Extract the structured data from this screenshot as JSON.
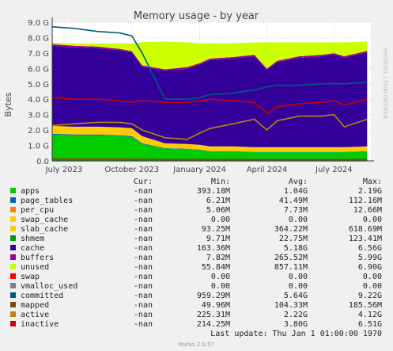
{
  "chart_data": {
    "type": "area",
    "title": "Memory usage - by year",
    "ylabel": "Bytes",
    "xlabel": "",
    "side_label": "RRDTOOL / TOBI OETIKER",
    "footer": "Munin 2.0.57",
    "ylim": [
      0,
      9000000000
    ],
    "xlim": [
      "2023-06-15",
      "2024-08-20"
    ],
    "grid": true,
    "y_ticks": [
      {
        "value": 0,
        "label": "0.0"
      },
      {
        "value": 1000000000,
        "label": "1.0 G"
      },
      {
        "value": 2000000000,
        "label": "2.0 G"
      },
      {
        "value": 3000000000,
        "label": "3.0 G"
      },
      {
        "value": 4000000000,
        "label": "4.0 G"
      },
      {
        "value": 5000000000,
        "label": "5.0 G"
      },
      {
        "value": 6000000000,
        "label": "6.0 G"
      },
      {
        "value": 7000000000,
        "label": "7.0 G"
      },
      {
        "value": 8000000000,
        "label": "8.0 G"
      },
      {
        "value": 9000000000,
        "label": "9.0 G"
      }
    ],
    "x_ticks": [
      {
        "date": "2023-07-01",
        "label": "July 2023"
      },
      {
        "date": "2023-10-01",
        "label": "October 2023"
      },
      {
        "date": "2024-01-01",
        "label": "January 2024"
      },
      {
        "date": "2024-04-01",
        "label": "April 2024"
      },
      {
        "date": "2024-07-01",
        "label": "July 2024"
      }
    ],
    "x": [
      "2023-06-15",
      "2023-07-15",
      "2023-08-15",
      "2023-09-15",
      "2023-10-01",
      "2023-10-15",
      "2023-11-15",
      "2023-12-15",
      "2024-01-01",
      "2024-01-15",
      "2024-02-15",
      "2024-03-15",
      "2024-04-01",
      "2024-04-15",
      "2024-05-15",
      "2024-06-15",
      "2024-07-01",
      "2024-07-15",
      "2024-08-15"
    ],
    "legend_header": {
      "cur": "Cur:",
      "min": "Min:",
      "avg": "Avg:",
      "max": "Max:"
    },
    "series": [
      {
        "name": "apps",
        "color": "#00cc00",
        "stacked": true,
        "cur": "-nan",
        "min": "393.18M",
        "avg": "1.04G",
        "max": "2.19G",
        "values": [
          1700000000,
          1650000000,
          1650000000,
          1600000000,
          1550000000,
          1100000000,
          800000000,
          750000000,
          700000000,
          600000000,
          600000000,
          550000000,
          550000000,
          550000000,
          550000000,
          550000000,
          550000000,
          550000000,
          600000000
        ]
      },
      {
        "name": "page_tables",
        "color": "#0066b3",
        "stacked": true,
        "cur": "-nan",
        "min": "6.21M",
        "avg": "41.49M",
        "max": "112.16M",
        "values": [
          60000000,
          60000000,
          60000000,
          60000000,
          60000000,
          40000000,
          30000000,
          30000000,
          30000000,
          30000000,
          30000000,
          30000000,
          30000000,
          30000000,
          30000000,
          30000000,
          30000000,
          30000000,
          30000000
        ]
      },
      {
        "name": "per_cpu",
        "color": "#ff8000",
        "stacked": true,
        "cur": "-nan",
        "min": "5.06M",
        "avg": "7.73M",
        "max": "12.66M",
        "values": [
          8000000,
          8000000,
          8000000,
          8000000,
          8000000,
          8000000,
          8000000,
          8000000,
          8000000,
          8000000,
          8000000,
          8000000,
          8000000,
          8000000,
          8000000,
          8000000,
          8000000,
          8000000,
          8000000
        ]
      },
      {
        "name": "swap_cache",
        "color": "#ffcc00",
        "stacked": true,
        "cur": "-nan",
        "min": "0.00",
        "avg": "0.00",
        "max": "0.00",
        "values": [
          0,
          0,
          0,
          0,
          0,
          0,
          0,
          0,
          0,
          0,
          0,
          0,
          0,
          0,
          0,
          0,
          0,
          0,
          0
        ]
      },
      {
        "name": "slab_cache",
        "color": "#ffcc00",
        "stacked": true,
        "cur": "-nan",
        "min": "93.25M",
        "avg": "364.22M",
        "max": "618.69M",
        "values": [
          500000000,
          500000000,
          500000000,
          500000000,
          500000000,
          450000000,
          300000000,
          300000000,
          300000000,
          300000000,
          300000000,
          300000000,
          300000000,
          300000000,
          300000000,
          300000000,
          300000000,
          300000000,
          300000000
        ]
      },
      {
        "name": "shmem",
        "color": "#009900",
        "stacked": false,
        "cur": "-nan",
        "min": "9.71M",
        "avg": "22.75M",
        "max": "123.41M",
        "values": [
          20000000,
          20000000,
          20000000,
          20000000,
          20000000,
          20000000,
          20000000,
          20000000,
          20000000,
          20000000,
          20000000,
          20000000,
          20000000,
          20000000,
          20000000,
          20000000,
          20000000,
          20000000,
          20000000
        ]
      },
      {
        "name": "cache",
        "color": "#330099",
        "stacked": true,
        "cur": "-nan",
        "min": "163.36M",
        "avg": "5.18G",
        "max": "6.56G",
        "values": [
          5200000000,
          5150000000,
          5100000000,
          5000000000,
          4900000000,
          4500000000,
          4700000000,
          4900000000,
          5200000000,
          5600000000,
          5700000000,
          5900000000,
          5000000000,
          5500000000,
          5800000000,
          5900000000,
          6000000000,
          5800000000,
          6100000000
        ]
      },
      {
        "name": "buffers",
        "color": "#990099",
        "stacked": true,
        "cur": "-nan",
        "min": "7.82M",
        "avg": "265.52M",
        "max": "5.99G",
        "values": [
          100000000,
          100000000,
          100000000,
          100000000,
          100000000,
          100000000,
          100000000,
          100000000,
          100000000,
          100000000,
          100000000,
          100000000,
          100000000,
          100000000,
          100000000,
          100000000,
          100000000,
          100000000,
          100000000
        ]
      },
      {
        "name": "unused",
        "color": "#ccff00",
        "stacked": true,
        "cur": "-nan",
        "min": "55.84M",
        "avg": "857.11M",
        "max": "6.90G",
        "values": [
          100000000,
          150000000,
          200000000,
          350000000,
          500000000,
          1500000000,
          1800000000,
          1600000000,
          1300000000,
          1000000000,
          900000000,
          800000000,
          1700000000,
          1200000000,
          900000000,
          800000000,
          700000000,
          900000000,
          600000000
        ]
      },
      {
        "name": "swap",
        "color": "#ff0000",
        "stacked": true,
        "cur": "-nan",
        "min": "0.00",
        "avg": "0.00",
        "max": "0.00",
        "values": [
          0,
          0,
          0,
          0,
          0,
          0,
          0,
          0,
          0,
          0,
          0,
          0,
          0,
          0,
          0,
          0,
          0,
          0,
          0
        ]
      },
      {
        "name": "vmalloc_used",
        "color": "#808080",
        "stacked": false,
        "cur": "-nan",
        "min": "0.00",
        "avg": "0.00",
        "max": "0.00",
        "values": [
          0,
          0,
          0,
          0,
          0,
          0,
          0,
          0,
          0,
          0,
          0,
          0,
          0,
          0,
          0,
          0,
          0,
          0,
          0
        ]
      },
      {
        "name": "committed",
        "color": "#005a80",
        "stacked": false,
        "cur": "-nan",
        "min": "959.29M",
        "avg": "5.64G",
        "max": "9.22G",
        "values": [
          8700000000,
          8600000000,
          8400000000,
          8300000000,
          8100000000,
          7000000000,
          4000000000,
          4000000000,
          4100000000,
          4300000000,
          4400000000,
          4600000000,
          4800000000,
          4900000000,
          4900000000,
          5000000000,
          5000000000,
          5000000000,
          5100000000
        ]
      },
      {
        "name": "mapped",
        "color": "#8a4500",
        "stacked": false,
        "cur": "-nan",
        "min": "49.96M",
        "avg": "104.33M",
        "max": "185.56M",
        "values": [
          120000000,
          120000000,
          120000000,
          120000000,
          110000000,
          100000000,
          90000000,
          90000000,
          90000000,
          90000000,
          90000000,
          90000000,
          90000000,
          90000000,
          90000000,
          90000000,
          90000000,
          90000000,
          90000000
        ]
      },
      {
        "name": "active",
        "color": "#b8860b",
        "stacked": false,
        "cur": "-nan",
        "min": "225.31M",
        "avg": "2.22G",
        "max": "4.12G",
        "values": [
          2300000000,
          2400000000,
          2500000000,
          2500000000,
          2400000000,
          2000000000,
          1500000000,
          1400000000,
          1800000000,
          2100000000,
          2400000000,
          2700000000,
          2000000000,
          2600000000,
          2900000000,
          2900000000,
          3000000000,
          2200000000,
          2700000000
        ]
      },
      {
        "name": "inactive",
        "color": "#cc0000",
        "stacked": false,
        "cur": "-nan",
        "min": "214.25M",
        "avg": "3.80G",
        "max": "6.51G",
        "values": [
          4100000000,
          4000000000,
          4000000000,
          3900000000,
          3800000000,
          3900000000,
          3800000000,
          3800000000,
          3900000000,
          4000000000,
          3900000000,
          3800000000,
          3100000000,
          3500000000,
          3700000000,
          3800000000,
          3900000000,
          3600000000,
          4000000000
        ]
      }
    ],
    "last_update": "Last update:  Thu Jan  1 01:00:00 1970"
  }
}
